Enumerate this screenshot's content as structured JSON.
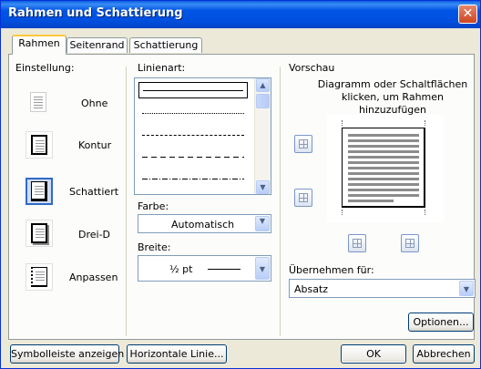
{
  "window": {
    "title": "Rahmen und Schattierung",
    "close": "✕"
  },
  "tabs": [
    {
      "label": "Rahmen",
      "active": true
    },
    {
      "label": "Seitenrand",
      "active": false
    },
    {
      "label": "Schattierung",
      "active": false
    }
  ],
  "einstellung": {
    "label": "Einstellung:",
    "options": [
      "Ohne",
      "Kontur",
      "Schattiert",
      "Drei-D",
      "Anpassen"
    ],
    "selected": "Schattiert"
  },
  "linienart": {
    "label": "Linienart:",
    "styles": [
      "solid",
      "dotted",
      "dashed-fine",
      "dashed",
      "dash-dot"
    ],
    "selected": "solid"
  },
  "farbe": {
    "label": "Farbe:",
    "value": "Automatisch"
  },
  "breite": {
    "label": "Breite:",
    "value": "½ pt"
  },
  "vorschau": {
    "label": "Vorschau",
    "hint": "Diagramm oder Schaltflächen klicken, um Rahmen hinzuzufügen"
  },
  "uebernehmen": {
    "label": "Übernehmen für:",
    "value": "Absatz"
  },
  "buttons": {
    "optionen": "Optionen...",
    "symbolleiste": "Symbolleiste anzeigen",
    "horizontale": "Horizontale Linie...",
    "ok": "OK",
    "abbrechen": "Abbrechen"
  },
  "colors": {
    "titlebar": "#0055e5",
    "dialog_bg": "#ece9d8",
    "panel_bg": "#fcfcfb",
    "selection": "#316ac5",
    "active_tab": "#ffc83c"
  }
}
